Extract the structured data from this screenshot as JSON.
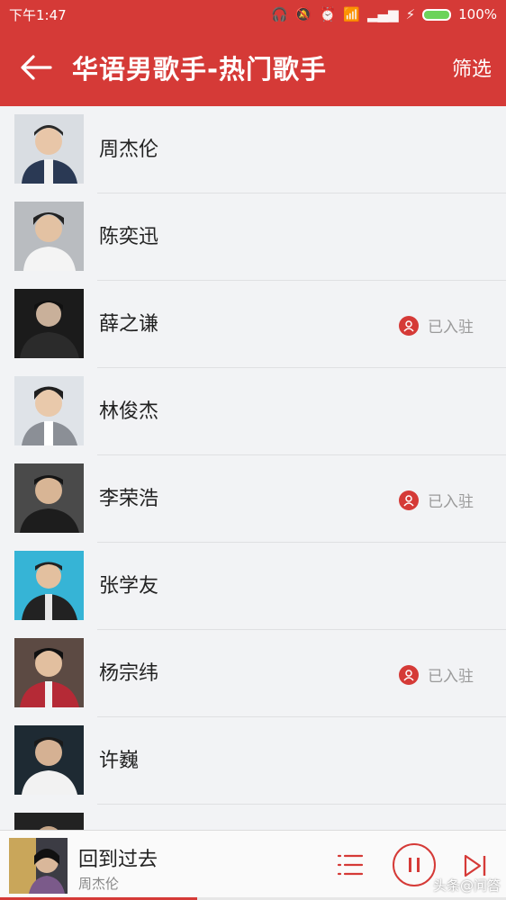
{
  "status": {
    "time": "下午1:47",
    "battery": "100%"
  },
  "header": {
    "title": "华语男歌手-热门歌手",
    "filter_label": "筛选"
  },
  "artists": [
    {
      "name": "周杰伦",
      "badge": ""
    },
    {
      "name": "陈奕迅",
      "badge": ""
    },
    {
      "name": "薛之谦",
      "badge": "已入驻"
    },
    {
      "name": "林俊杰",
      "badge": ""
    },
    {
      "name": "李荣浩",
      "badge": "已入驻"
    },
    {
      "name": "张学友",
      "badge": ""
    },
    {
      "name": "杨宗纬",
      "badge": "已入驻"
    },
    {
      "name": "许巍",
      "badge": ""
    }
  ],
  "player": {
    "song": "回到过去",
    "artist": "周杰伦",
    "progress": 0.39
  },
  "watermark": "头条@问答",
  "colors": {
    "brand": "#d53a37"
  }
}
